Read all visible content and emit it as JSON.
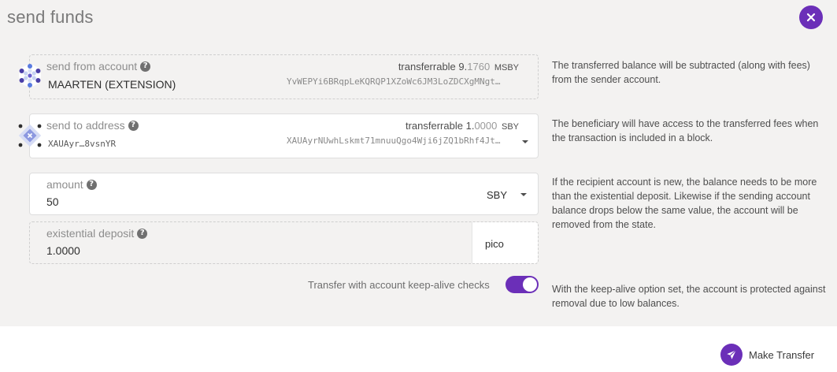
{
  "modal": {
    "title": "send funds",
    "close_icon": "close-icon"
  },
  "send_from": {
    "label": "send from account",
    "balance_label": "transferrable",
    "balance_int": "9.",
    "balance_dec": "1760",
    "balance_unit": "MSBY",
    "account_name": "MAARTEN (EXTENSION)",
    "address": "YvWEPYi6BRqpLeKQRQP1XZoWc6JM3LoZDCXgMNgt…"
  },
  "send_to": {
    "label": "send to address",
    "balance_label": "transferrable",
    "balance_int": "1.",
    "balance_dec": "0000",
    "balance_unit": "SBY",
    "account_short": "XAUAyr…8vsnYR",
    "address": "XAUAyrNUwhLskmt71mnuuQgo4Wji6jZQ1bRhf4Jt…"
  },
  "amount": {
    "label": "amount",
    "value": "50",
    "unit": "SBY"
  },
  "existential": {
    "label": "existential deposit",
    "value": "1.0000",
    "unit": "pico"
  },
  "keep_alive": {
    "label": "Transfer with account keep-alive checks",
    "enabled": true
  },
  "help": {
    "from": "The transferred balance will be subtracted (along with fees) from the sender account.",
    "to": "The beneficiary will have access to the transferred fees when the transaction is included in a block.",
    "amount": "If the recipient account is new, the balance needs to be more than the existential deposit. Likewise if the sending account balance drops below the same value, the account will be removed from the state.",
    "keep_alive": "With the keep-alive option set, the account is protected against removal due to low balances."
  },
  "actions": {
    "make_transfer": "Make Transfer"
  },
  "colors": {
    "accent": "#6b2fb8",
    "modal_bg": "#f3f2f1"
  }
}
